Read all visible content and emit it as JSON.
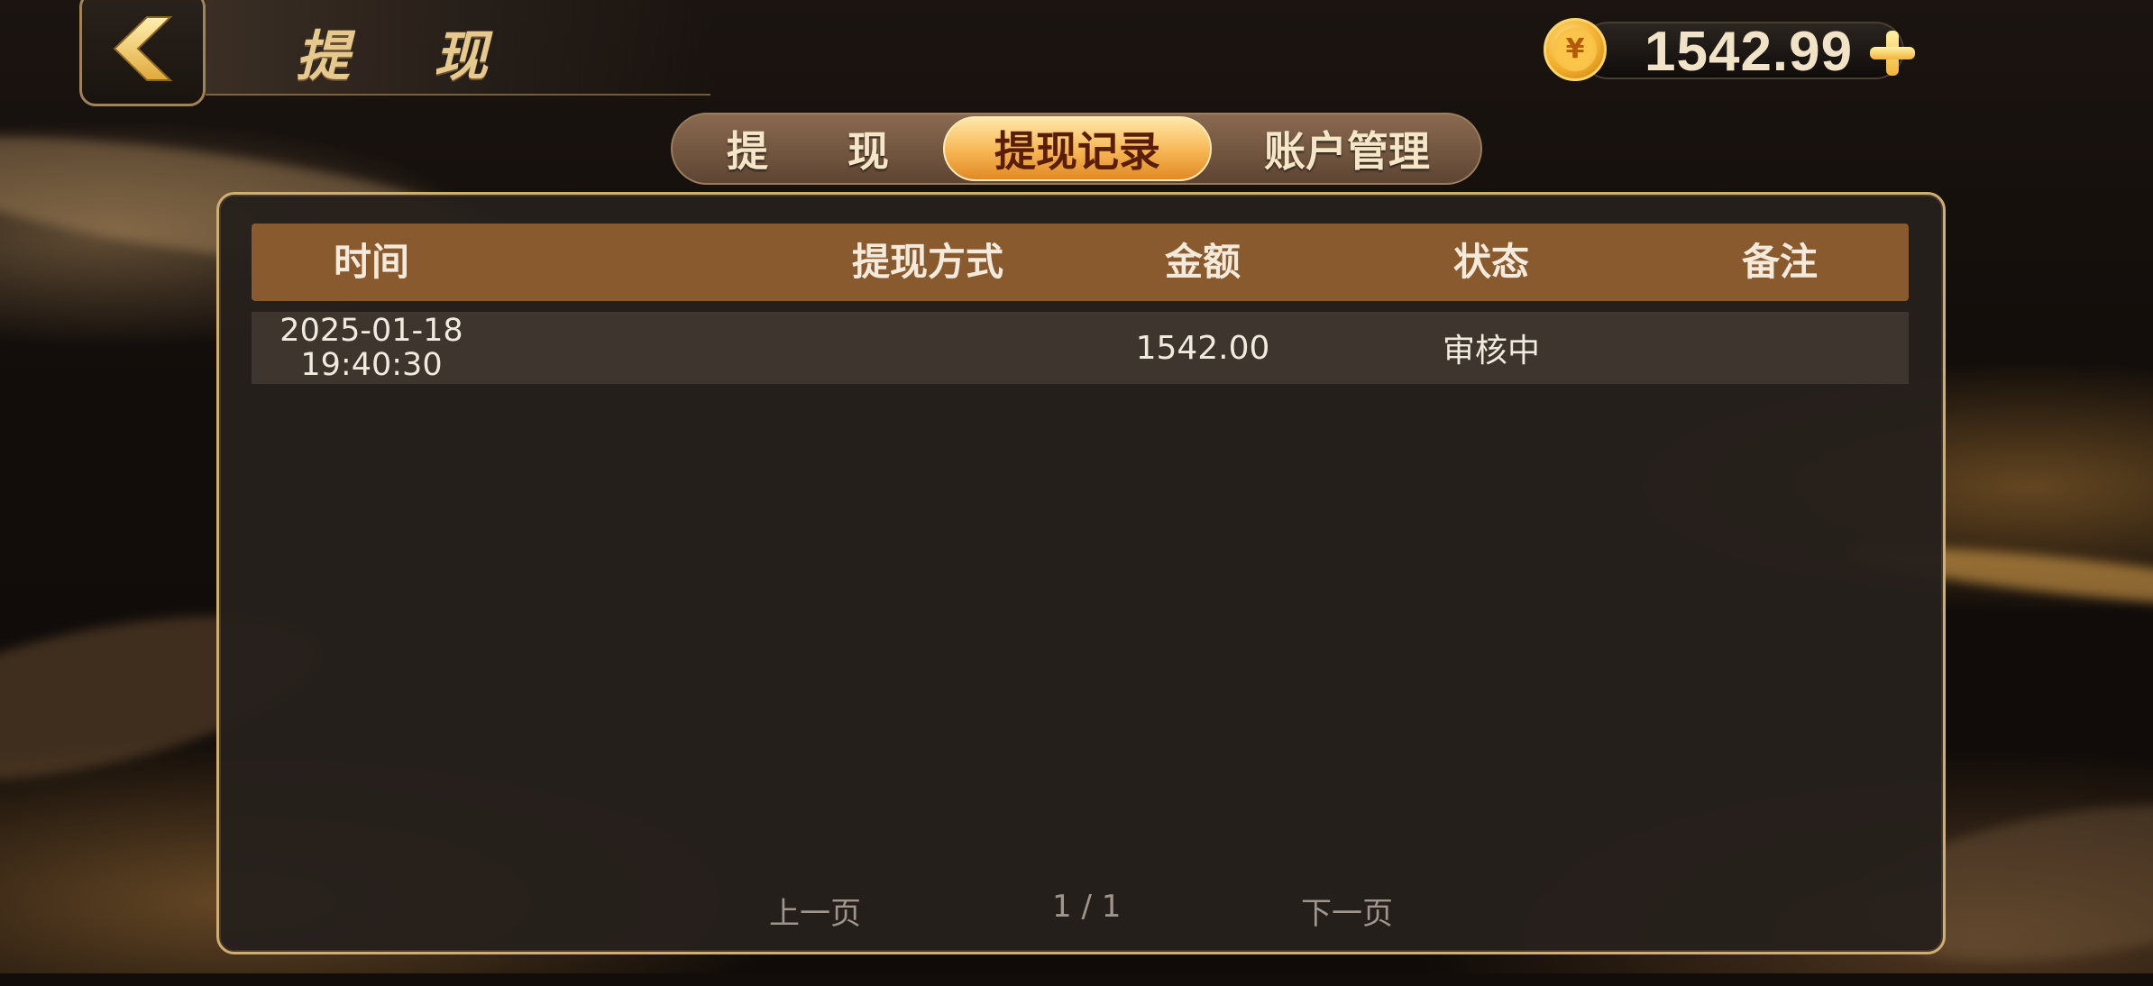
{
  "header": {
    "title": "提 现",
    "balance": "1542.99",
    "coin_symbol": "¥"
  },
  "tabs": [
    {
      "label": "提 现",
      "active": false
    },
    {
      "label": "提现记录",
      "active": true
    },
    {
      "label": "账户管理",
      "active": false
    }
  ],
  "table": {
    "columns": [
      "时间",
      "提现方式",
      "金额",
      "状态",
      "备注"
    ],
    "rows": [
      {
        "date": "2025-01-18",
        "time": "19:40:30",
        "method": "",
        "amount": "1542.00",
        "status": "审核中",
        "note": ""
      }
    ]
  },
  "pagination": {
    "prev_label": "上一页",
    "page_indicator": "1 / 1",
    "next_label": "下一页"
  },
  "colors": {
    "accent_gold": "#e6c98d",
    "active_tab": "#f6b552",
    "table_header": "#8a5a2f"
  }
}
